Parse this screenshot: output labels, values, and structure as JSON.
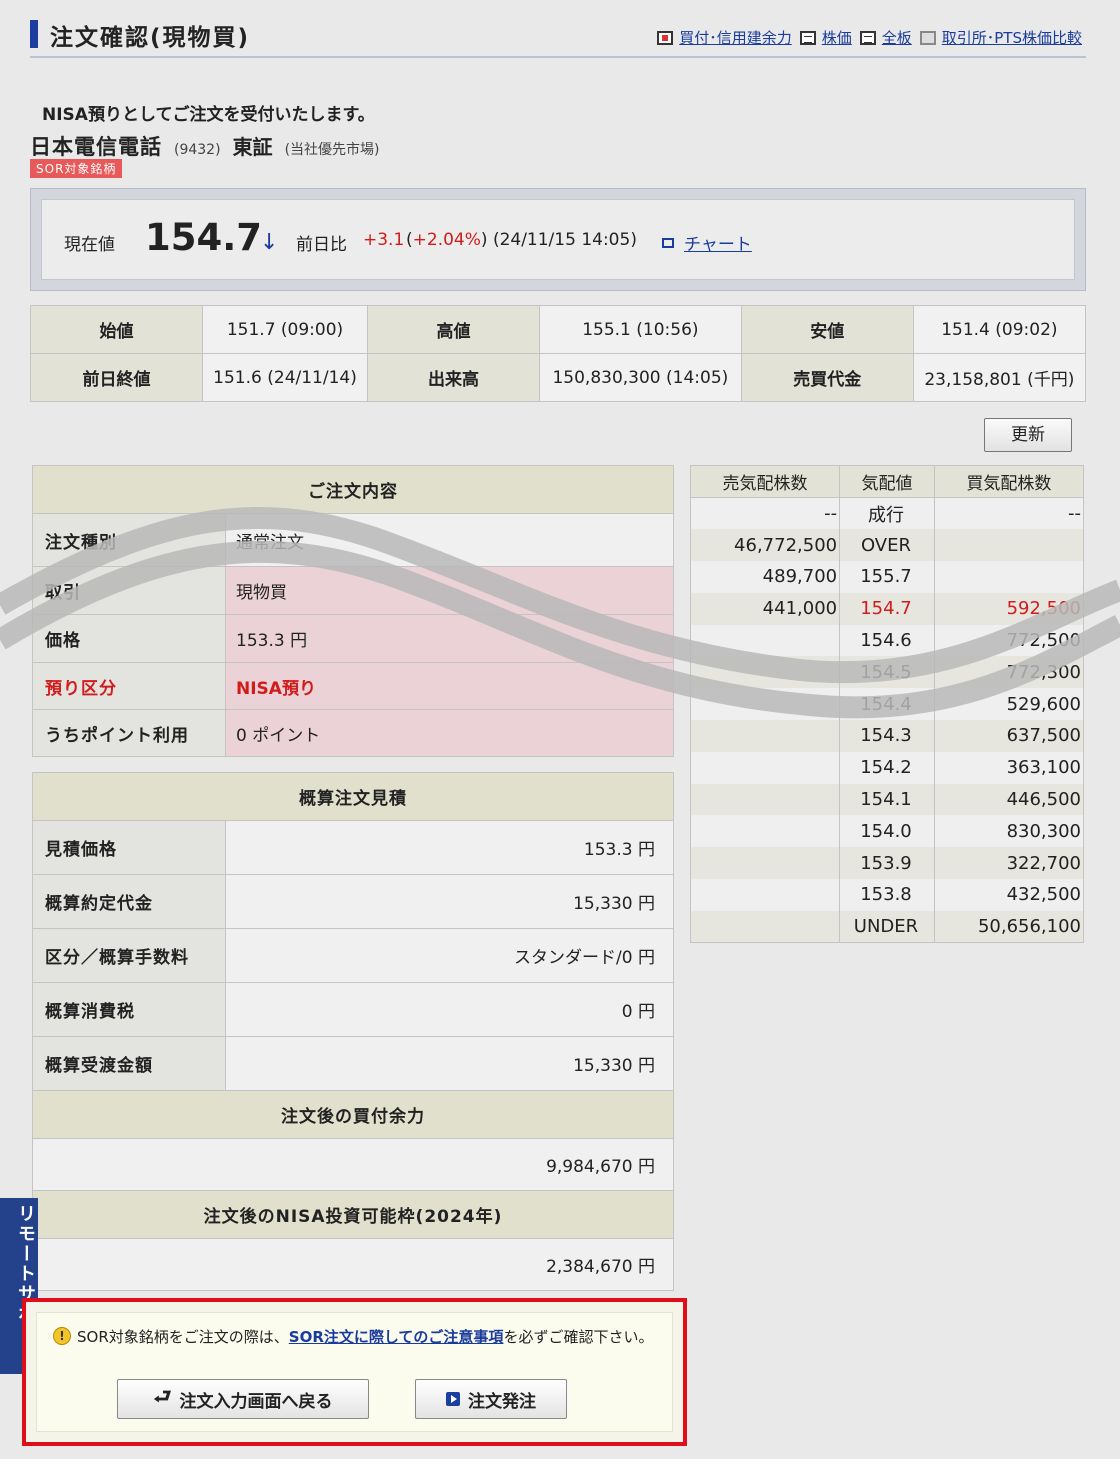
{
  "header": {
    "title": "注文確認(現物買)",
    "links": [
      {
        "label": "買付･信用建余力",
        "icon": "calculator-icon"
      },
      {
        "label": "株価",
        "icon": "list-icon"
      },
      {
        "label": "全板",
        "icon": "board-icon"
      },
      {
        "label": "取引所･PTS株価比較",
        "icon": "printer-icon"
      }
    ]
  },
  "notice": "NISA預りとしてご注文を受付いたします。",
  "stock": {
    "name": "日本電信電話",
    "code": "(9432)",
    "market": "東証",
    "market_note": "(当社優先市場)",
    "badge": "SOR対象銘柄"
  },
  "price": {
    "current_label": "現在値",
    "current": "154.7",
    "arrow": "↓",
    "diff_label": "前日比",
    "diff": "+3.1",
    "diff_pct_open": "(",
    "diff_pct": "+2.04%",
    "diff_pct_close": ")",
    "timestamp": "(24/11/15 14:05)",
    "chart_label": "チャート"
  },
  "stats": {
    "open_label": "始値",
    "open": "151.7 (09:00)",
    "high_label": "高値",
    "high": "155.1 (10:56)",
    "low_label": "安値",
    "low": "151.4 (09:02)",
    "prev_label": "前日終値",
    "prev": "151.6 (24/11/14)",
    "volume_label": "出来高",
    "volume": "150,830,300 (14:05)",
    "turnover_label": "売買代金",
    "turnover": "23,158,801 (千円)"
  },
  "refresh_label": "更新",
  "order": {
    "header": "ご注文内容",
    "type_label": "注文種別",
    "type": "通常注文",
    "trade_label": "取引",
    "trade": "現物買",
    "price_label": "価格",
    "price": "153.3 円",
    "account_label": "預り区分",
    "account": "NISA預り",
    "points_label": "うちポイント利用",
    "points": "0 ポイント"
  },
  "estimate": {
    "header": "概算注文見積",
    "est_price_label": "見積価格",
    "est_price": "153.3 円",
    "amount_label": "概算約定代金",
    "amount": "15,330 円",
    "fee_label": "区分／概算手数料",
    "fee": "スタンダード/0 円",
    "tax_label": "概算消費税",
    "tax": "0 円",
    "total_label": "概算受渡金額",
    "total": "15,330 円",
    "buying_power_header": "注文後の買付余力",
    "buying_power": "9,984,670 円",
    "nisa_header": "注文後のNISA投資可能枠(2024年)",
    "nisa": "2,384,670 円"
  },
  "book": {
    "headers": [
      "売気配株数",
      "気配値",
      "買気配株数"
    ],
    "rows": [
      [
        "--",
        "成行",
        "--"
      ],
      [
        "46,772,500",
        "OVER",
        ""
      ],
      [
        "489,700",
        "155.7",
        ""
      ],
      [
        "441,000",
        "154.7",
        "592,500"
      ],
      [
        "",
        "154.6",
        "772,500"
      ],
      [
        "",
        "154.5",
        "772,300"
      ],
      [
        "",
        "154.4",
        "529,600"
      ],
      [
        "",
        "154.3",
        "637,500"
      ],
      [
        "",
        "154.2",
        "363,100"
      ],
      [
        "",
        "154.1",
        "446,500"
      ],
      [
        "",
        "154.0",
        "830,300"
      ],
      [
        "",
        "153.9",
        "322,700"
      ],
      [
        "",
        "153.8",
        "432,500"
      ],
      [
        "",
        "UNDER",
        "50,656,100"
      ]
    ]
  },
  "remote_support": "リモートサポート",
  "footer": {
    "notice_before": "SOR対象銘柄をご注文の際は、",
    "notice_link": "SOR注文に際してのご注意事項",
    "notice_after": "を必ずご確認下さい。",
    "back_button": "注文入力画面へ戻る",
    "submit_button": "注文発注"
  },
  "colors": {
    "accent": "#1b3fa0",
    "up": "#d21b1b",
    "highlight_frame": "#e00d1a"
  }
}
